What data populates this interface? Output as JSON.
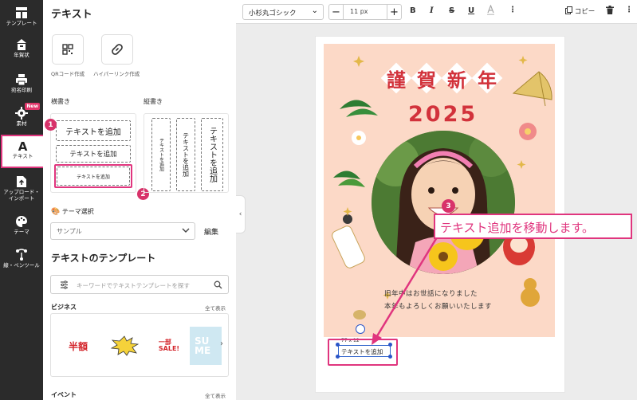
{
  "sidebar": {
    "items": [
      {
        "label": "テンプレート",
        "icon": "template-icon"
      },
      {
        "label": "年賀状",
        "icon": "new-year-card-icon"
      },
      {
        "label": "宛名印刷",
        "icon": "printer-icon"
      },
      {
        "label": "素材",
        "icon": "materials-icon",
        "badge": "New"
      },
      {
        "label": "テキスト",
        "icon": "text-a-icon",
        "active": true
      },
      {
        "label": "アップロード・\nインポート",
        "icon": "upload-icon"
      },
      {
        "label": "テーマ",
        "icon": "palette-icon"
      },
      {
        "label": "線・ペンツール",
        "icon": "pen-tool-icon"
      }
    ]
  },
  "panel": {
    "title": "テキスト",
    "qr_label": "QRコード作成",
    "hyperlink_label": "ハイパーリンク作成",
    "horizontal_label": "横書き",
    "vertical_label": "縦書き",
    "h_buttons": [
      "テキストを追加",
      "テキストを追加",
      "テキストを追加"
    ],
    "v_buttons": [
      "テキストを追加",
      "テキストを追加",
      "テキストを追加"
    ],
    "theme_label": "テーマ選択",
    "theme_value": "サンプル",
    "edit_label": "編集",
    "templates_title": "テキストのテンプレート",
    "search_placeholder": "キーワードでテキストテンプレートを探す",
    "business_label": "ビジネス",
    "event_label": "イベント",
    "see_all": "全て表示",
    "thumbs": [
      "半額",
      "",
      "一部\nSALE!",
      "SU\nME"
    ]
  },
  "steps": [
    "1",
    "2",
    "3"
  ],
  "toolbar": {
    "font": "小杉丸ゴシック",
    "size": "11 px",
    "copy_label": "コピー",
    "bold": "B",
    "italic": "I",
    "strike": "S",
    "underline": "U"
  },
  "card": {
    "title": [
      "謹",
      "賀",
      "新",
      "年"
    ],
    "year": "2025",
    "message_line1": "旧年中はお世話になりました",
    "message_line2": "本年もよろしくお願いいたします"
  },
  "selection": {
    "text": "テキストを追加",
    "size_label": "77 x 12"
  },
  "tip": "テキスト追加を移動します。",
  "colors": {
    "accent": "#e0357e",
    "card_bg": "#fcd9c7",
    "title_red": "#d2323b",
    "rail": "#2b2b2b"
  }
}
